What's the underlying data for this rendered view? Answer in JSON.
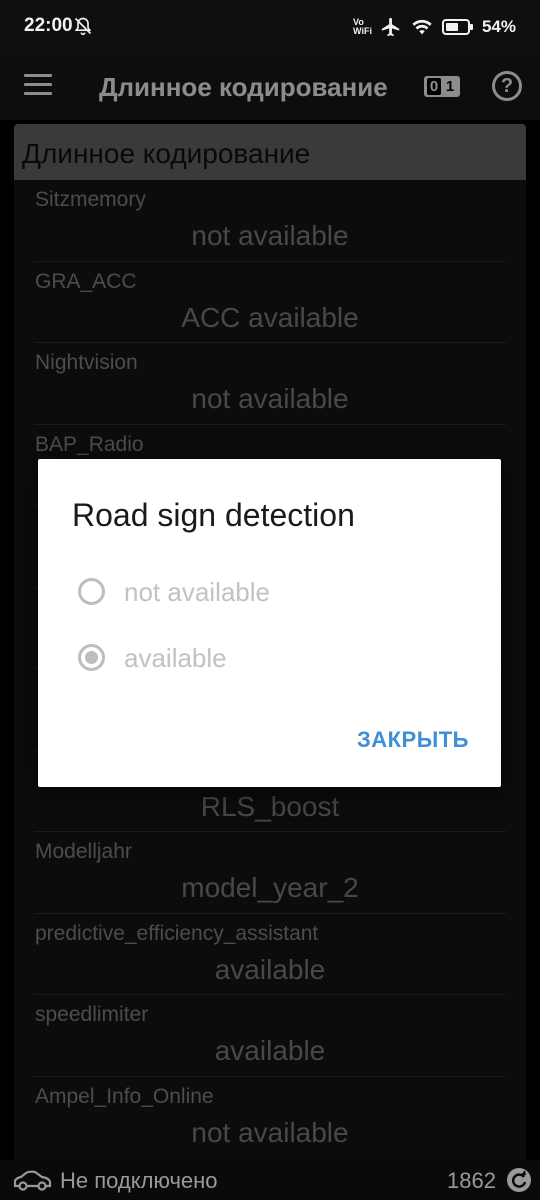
{
  "status_bar": {
    "time": "22:00",
    "vowifi_top": "Vo",
    "vowifi_bottom": "WiFi",
    "battery": "54%"
  },
  "app_bar": {
    "title": "Длинное кодирование",
    "toggle_left": "0",
    "toggle_right": "1",
    "help": "?"
  },
  "list": {
    "header": "Длинное кодирование",
    "rows": [
      {
        "label": "Sitzmemory",
        "value": "not available"
      },
      {
        "label": "GRA_ACC",
        "value": "ACC available"
      },
      {
        "label": "Nightvision",
        "value": "not available"
      },
      {
        "label": "BAP_Radio",
        "value": ""
      },
      {
        "label": "",
        "value": ""
      },
      {
        "label": "",
        "value": ""
      },
      {
        "label": "",
        "value": ""
      },
      {
        "label": "",
        "value": "RLS_boost"
      },
      {
        "label": "Modelljahr",
        "value": "model_year_2"
      },
      {
        "label": "predictive_efficiency_assistant",
        "value": "available"
      },
      {
        "label": "speedlimiter",
        "value": "available"
      },
      {
        "label": "Ampel_Info_Online",
        "value": "not available"
      }
    ]
  },
  "dialog": {
    "title": "Road sign detection",
    "options": [
      {
        "label": "not available",
        "selected": false
      },
      {
        "label": "available",
        "selected": true
      }
    ],
    "close_label": "ЗАКРЫТЬ"
  },
  "bottom_bar": {
    "connection": "Не подключено",
    "counter": "1862"
  },
  "colors": {
    "accent": "#3f8fd4",
    "header_bg": "#6a6a6a",
    "radio_disabled": "#bdbdbd"
  }
}
